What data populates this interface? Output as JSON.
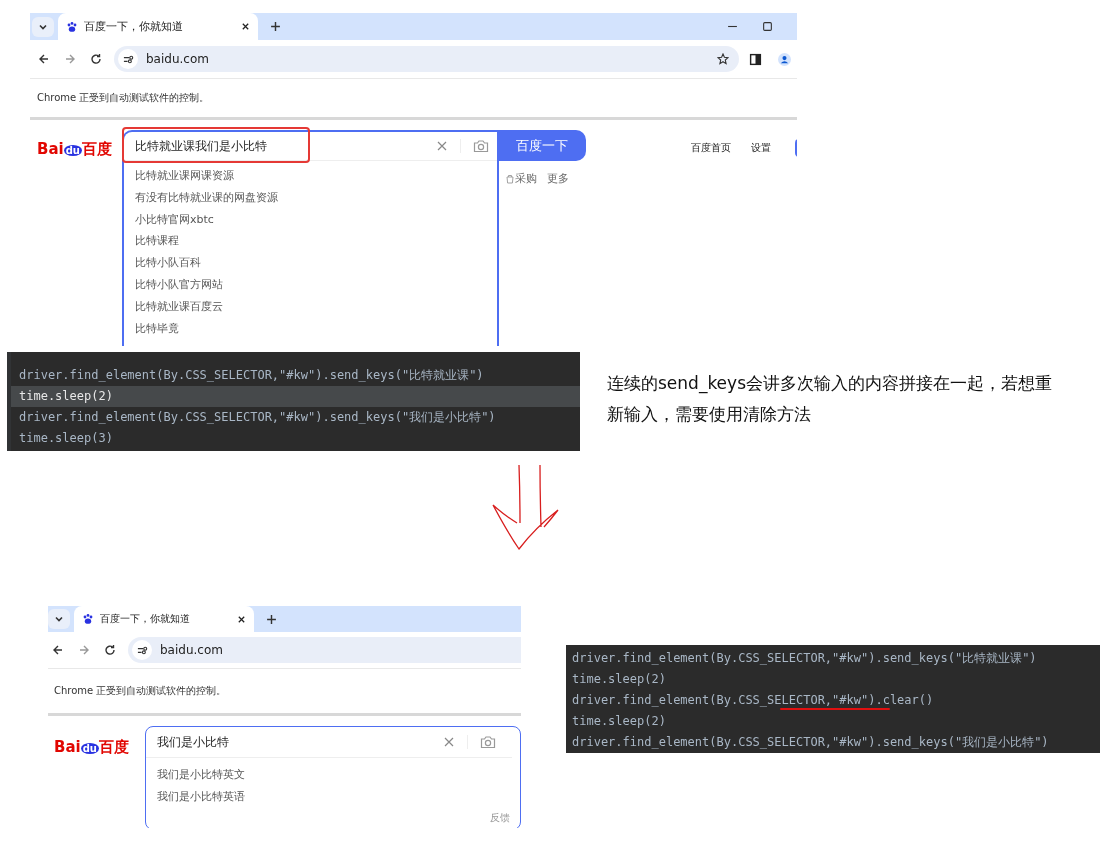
{
  "browsers": [
    {
      "tab_title": "百度一下，你就知道",
      "address": "baidu.com",
      "toolbar_icons": true,
      "notice": "Chrome 正受到自动测试软件的控制。",
      "logo": [
        "Bai",
        "du",
        "百度"
      ],
      "search_value": "比特就业课我们是小比特",
      "highlighted": true,
      "search_button": "百度一下",
      "nav_links": [
        "百度首页",
        "设置"
      ],
      "suggestions": [
        "比特就业课网课资源",
        "有没有比特就业课的网盘资源",
        "小比特官网xbtc",
        "比特课程",
        "比特小队百科",
        "比特小队官方网站",
        "比特就业课百度云",
        "比特毕竟"
      ],
      "side_links": [
        "采购",
        "更多"
      ]
    },
    {
      "tab_title": "百度一下，你就知道",
      "address": "baidu.com",
      "notice": "Chrome 正受到自动测试软件的控制。",
      "logo": [
        "Bai",
        "du",
        "百度"
      ],
      "search_value": "我们是小比特",
      "suggestions": [
        "我们是小比特英文",
        "我们是小比特英语"
      ],
      "feedback": "反馈"
    }
  ],
  "code_panels": [
    {
      "lines": [
        {
          "text": "driver.find_element(By.CSS_SELECTOR,\"#kw\").send_keys(\"比特就业课\")",
          "current": false
        },
        {
          "text": "time.sleep(2)",
          "current": true
        },
        {
          "text": "driver.find_element(By.CSS_SELECTOR,\"#kw\").send_keys(\"我们是小比特\")",
          "current": false
        },
        {
          "text": "time.sleep(3)",
          "current": false
        }
      ]
    },
    {
      "lines": [
        {
          "text": "driver.find_element(By.CSS_SELECTOR,\"#kw\").send_keys(\"比特就业课\")",
          "current": false,
          "underlined": false
        },
        {
          "text": "time.sleep(2)",
          "current": false,
          "underlined": false
        },
        {
          "text": "driver.find_element(By.CSS_SELECTOR,\"#kw\").clear()",
          "current": false,
          "underlined": true
        },
        {
          "text": "time.sleep(2)",
          "current": false,
          "underlined": false
        },
        {
          "text": "driver.find_element(By.CSS_SELECTOR,\"#kw\").send_keys(\"我们是小比特\")",
          "current": false,
          "underlined": false
        }
      ]
    }
  ],
  "note": "连续的send_keys会讲多次输入的内容拼接在一起，若想重新输入，需要使用清除方法"
}
